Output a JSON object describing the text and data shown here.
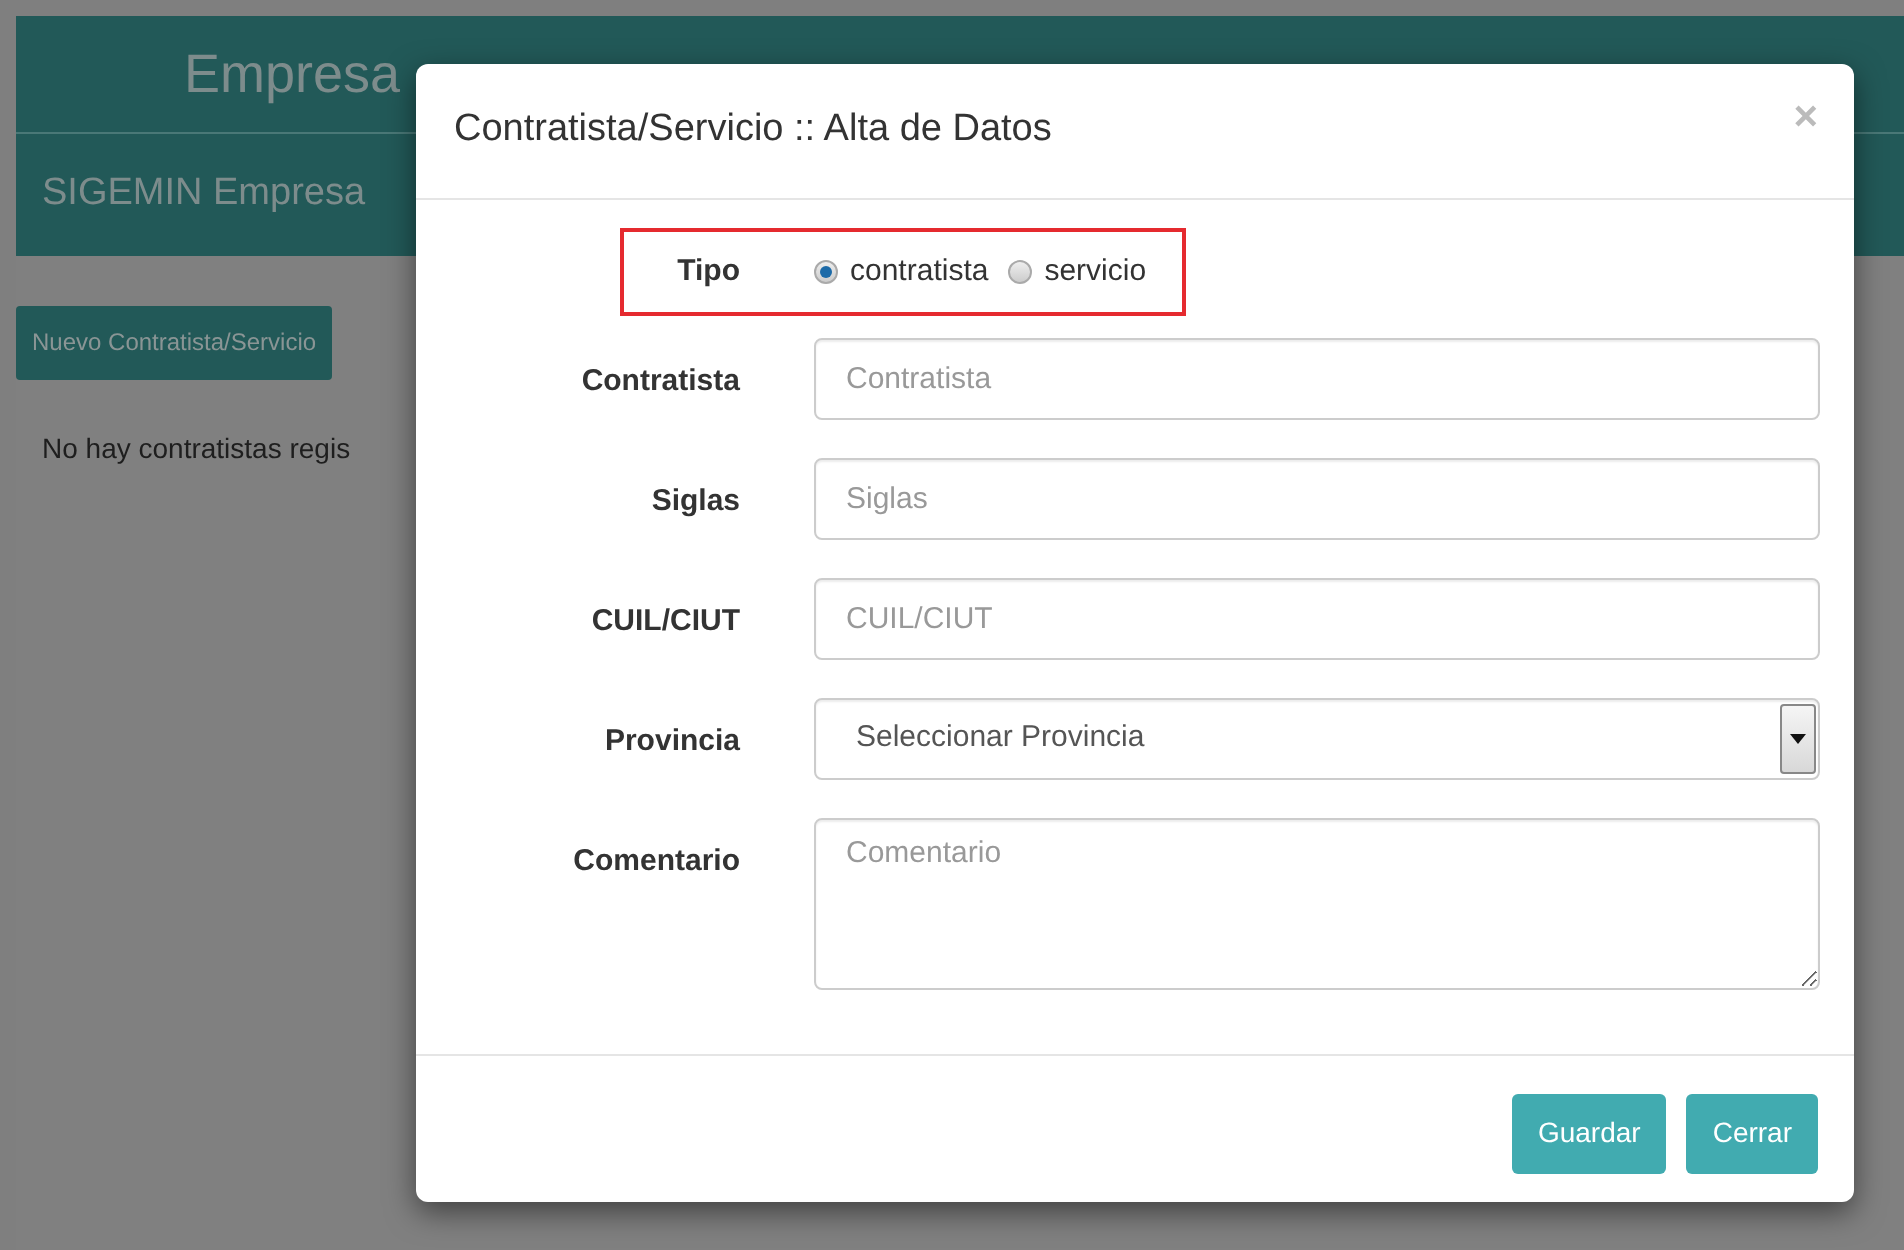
{
  "page": {
    "company_title": "Empresa",
    "app_title": "SIGEMIN Empresa",
    "new_button": "Nuevo Contratista/Servicio",
    "empty_message": "No hay contratistas regis"
  },
  "modal": {
    "title": "Contratista/Servicio :: Alta de Datos",
    "close": "×",
    "tipo": {
      "label": "Tipo",
      "highlighted": true,
      "options": [
        {
          "label": "contratista",
          "selected": true
        },
        {
          "label": "servicio",
          "selected": false
        }
      ]
    },
    "fields": [
      {
        "kind": "input",
        "label": "Contratista",
        "placeholder": "Contratista"
      },
      {
        "kind": "input",
        "label": "Siglas",
        "placeholder": "Siglas"
      },
      {
        "kind": "input",
        "label": "CUIL/CIUT",
        "placeholder": "CUIL/CIUT"
      },
      {
        "kind": "select",
        "label": "Provincia",
        "value": "Seleccionar Provincia"
      },
      {
        "kind": "textarea",
        "label": "Comentario",
        "placeholder": "Comentario"
      }
    ],
    "buttons": [
      "Guardar",
      "Cerrar"
    ]
  }
}
